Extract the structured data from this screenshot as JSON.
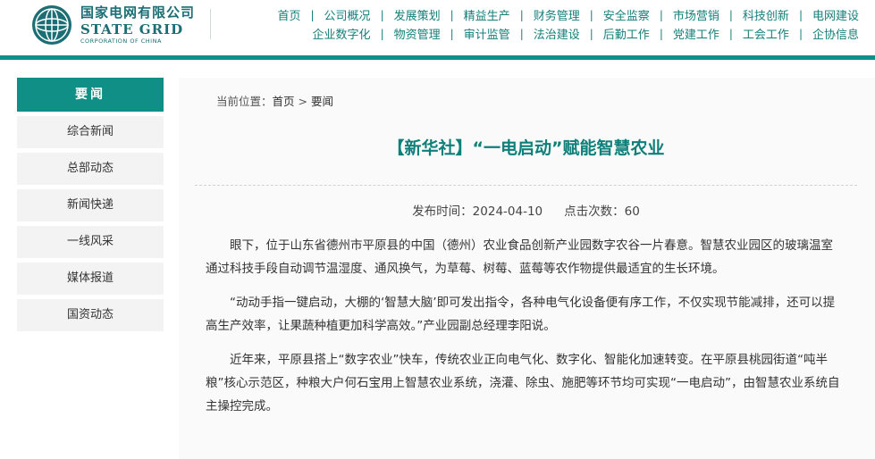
{
  "header": {
    "logo_cn": "国家电网有限公司",
    "logo_en": "STATE GRID",
    "logo_sub": "CORPORATION OF CHINA",
    "brand_color": "#0f8f85",
    "nav_row1": [
      "首页",
      "公司概况",
      "发展策划",
      "精益生产",
      "财务管理",
      "安全监察",
      "市场营销",
      "科技创新",
      "电网建设"
    ],
    "nav_row2": [
      "企业数字化",
      "物资管理",
      "审计监管",
      "法治建设",
      "后勤工作",
      "党建工作",
      "工会工作",
      "企协信息"
    ]
  },
  "sidebar": {
    "title": "要闻",
    "items": [
      "综合新闻",
      "总部动态",
      "新闻快递",
      "一线风采",
      "媒体报道",
      "国资动态"
    ]
  },
  "breadcrumb": {
    "prefix": "当前位置：",
    "home": "首页",
    "sep": " > ",
    "current": "要闻"
  },
  "article": {
    "title": "【新华社】“一电启动”赋能智慧农业",
    "publish_time": "发布时间：2024-04-10",
    "views": "点击次数：60",
    "paragraphs": [
      "眼下，位于山东省德州市平原县的中国（德州）农业食品创新产业园数字农谷一片春意。智慧农业园区的玻璃温室通过科技手段自动调节温湿度、通风换气，为草莓、树莓、蓝莓等农作物提供最适宜的生长环境。",
      "“动动手指一键启动，大棚的‘智慧大脑’即可发出指令，各种电气化设备便有序工作，不仅实现节能减排，还可以提高生产效率，让果蔬种植更加科学高效。”产业园副总经理李阳说。",
      "近年来，平原县搭上“数字农业”快车，传统农业正向电气化、数字化、智能化加速转变。在平原县桃园街道“吨半粮”核心示范区，种粮大户何石宝用上智慧农业系统，浇灌、除虫、施肥等环节均可实现“一电启动”，由智慧农业系统自主操控完成。"
    ]
  }
}
